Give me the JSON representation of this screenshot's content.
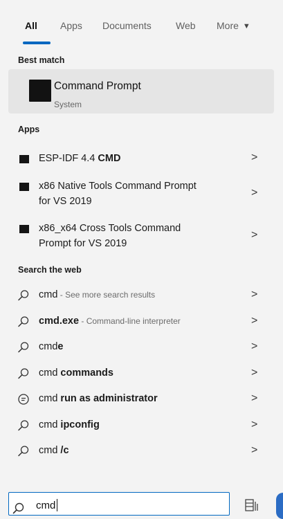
{
  "tabs": [
    {
      "label": "All"
    },
    {
      "label": "Apps"
    },
    {
      "label": "Documents"
    },
    {
      "label": "Web"
    },
    {
      "label": "More"
    }
  ],
  "best_match": {
    "section_label": "Best match",
    "title": "Command Prompt",
    "subtitle": "System"
  },
  "apps": {
    "section_label": "Apps",
    "items": [
      {
        "line1_pre": "ESP-IDF 4.4 ",
        "line1_bold": "CMD"
      },
      {
        "line1": "x86 Native Tools Command Prompt",
        "line2": "for VS 2019"
      },
      {
        "line1": "x86_x64 Cross Tools Command",
        "line2": "Prompt for VS 2019"
      }
    ]
  },
  "web": {
    "section_label": "Search the web",
    "items": [
      {
        "main": "cmd",
        "bold": "",
        "hint": " - See more search results",
        "icon": "search-icon"
      },
      {
        "main": "",
        "bold": "cmd.exe",
        "hint": " - Command-line interpreter",
        "icon": "search-icon"
      },
      {
        "main": "cmd",
        "bold": "e",
        "hint": "",
        "icon": "search-icon"
      },
      {
        "main": "cmd ",
        "bold": "commands",
        "hint": "",
        "icon": "search-icon"
      },
      {
        "main": "cmd ",
        "bold": "run as administrator",
        "hint": "",
        "icon": "chat-bubble-icon"
      },
      {
        "main": "cmd ",
        "bold": "ipconfig",
        "hint": "",
        "icon": "search-icon"
      },
      {
        "main": "cmd ",
        "bold": "/c",
        "hint": "",
        "icon": "search-icon"
      }
    ]
  },
  "search": {
    "value": "cmd"
  },
  "chevron": ">",
  "colors": {
    "accent": "#0067c0",
    "panel": "#f3f3f3",
    "selected": "#e5e5e5"
  }
}
